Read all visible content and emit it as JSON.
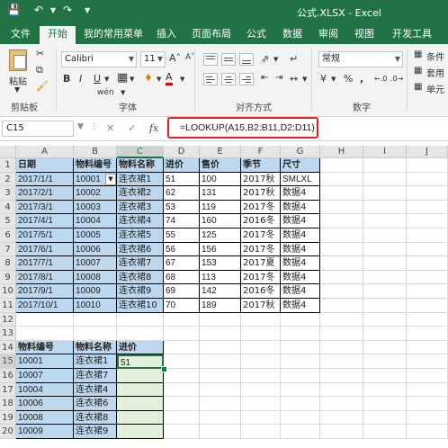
{
  "window": {
    "title": "公式.XLSX - Excel"
  },
  "tabs": [
    "文件",
    "开始",
    "我的常用菜单",
    "插入",
    "页面布局",
    "公式",
    "数据",
    "审阅",
    "视图",
    "开发工具"
  ],
  "ribbon": {
    "paste_label": "粘贴",
    "clipboard_label": "剪贴板",
    "font_name": "Calibri",
    "font_size": "11",
    "font_group_label": "字体",
    "align_group_label": "对齐方式",
    "number_format": "常规",
    "number_group_label": "数字",
    "right_items": [
      "条件",
      "套用",
      "单元"
    ]
  },
  "formula_bar": {
    "name_box": "C15",
    "fx": "fx",
    "formula": "=LOOKUP(A15,B2:B11,D2:D11)"
  },
  "columns": [
    "A",
    "B",
    "C",
    "D",
    "E",
    "F",
    "G",
    "H",
    "I",
    "J"
  ],
  "rows": [
    "1",
    "2",
    "3",
    "4",
    "5",
    "6",
    "7",
    "8",
    "9",
    "10",
    "11",
    "12",
    "13",
    "14",
    "15",
    "16",
    "17",
    "18",
    "19",
    "20"
  ],
  "table1": {
    "headers": [
      "日期",
      "物料编号",
      "物料名称",
      "进价",
      "售价",
      "季节",
      "尺寸"
    ],
    "rows": [
      [
        "2017/1/1",
        "10001",
        "连衣裙1",
        "51",
        "100",
        "2017秋",
        "SMLXL"
      ],
      [
        "2017/2/1",
        "10002",
        "连衣裙2",
        "62",
        "131",
        "2017秋",
        "数据4"
      ],
      [
        "2017/3/1",
        "10003",
        "连衣裙3",
        "53",
        "119",
        "2017冬",
        "数据4"
      ],
      [
        "2017/4/1",
        "10004",
        "连衣裙4",
        "74",
        "160",
        "2016冬",
        "数据4"
      ],
      [
        "2017/5/1",
        "10005",
        "连衣裙5",
        "55",
        "125",
        "2017冬",
        "数据4"
      ],
      [
        "2017/6/1",
        "10006",
        "连衣裙6",
        "56",
        "156",
        "2017冬",
        "数据4"
      ],
      [
        "2017/7/1",
        "10007",
        "连衣裙7",
        "67",
        "153",
        "2017夏",
        "数据4"
      ],
      [
        "2017/8/1",
        "10008",
        "连衣裙8",
        "68",
        "113",
        "2017冬",
        "数据4"
      ],
      [
        "2017/9/1",
        "10009",
        "连衣裙9",
        "69",
        "142",
        "2016冬",
        "数据4"
      ],
      [
        "2017/10/1",
        "10010",
        "连衣裙10",
        "70",
        "189",
        "2017秋",
        "数据4"
      ]
    ]
  },
  "table2": {
    "headers": [
      "物料编号",
      "物料名称",
      "进价"
    ],
    "rows": [
      [
        "10001",
        "连衣裙1",
        "51"
      ],
      [
        "10007",
        "连衣裙7",
        ""
      ],
      [
        "10004",
        "连衣裙4",
        ""
      ],
      [
        "10006",
        "连衣裙6",
        ""
      ],
      [
        "10008",
        "连衣裙8",
        ""
      ],
      [
        "10009",
        "连衣裙9",
        ""
      ]
    ]
  },
  "colors": {
    "excel_green": "#217346",
    "table_blue": "#bdd7ee",
    "highlight_green": "#e2efda",
    "formula_highlight": "#e02020"
  }
}
